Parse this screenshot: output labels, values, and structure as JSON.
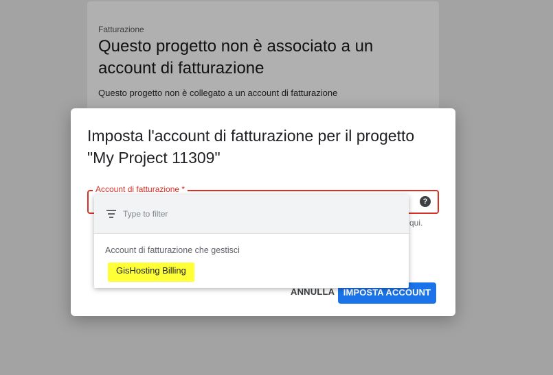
{
  "background": {
    "eyebrow": "Fatturazione",
    "title": "Questo progetto non è associato a un account di fatturazione",
    "body": "Questo progetto non è collegato a un account di fatturazione"
  },
  "dialog": {
    "title": "Imposta l'account di fatturazione per il progetto \"My Project 11309\"",
    "field_label": "Account di fatturazione *",
    "help_icon": "?",
    "hint_tail": "qui.",
    "cancel_label": "ANNULLA",
    "submit_label": "IMPOSTA ACCOUNT"
  },
  "dropdown": {
    "filter_placeholder": "Type to filter",
    "filter_value": "",
    "section_header": "Account di fatturazione che gestisci",
    "options": [
      {
        "label": "GisHosting Billing",
        "highlighted": true
      }
    ]
  },
  "colors": {
    "scrim": "#a3a3a3",
    "error": "#d93025",
    "primary": "#1a73e8",
    "highlight": "#ffff38"
  },
  "icons": [
    "help-icon",
    "filter-icon"
  ]
}
